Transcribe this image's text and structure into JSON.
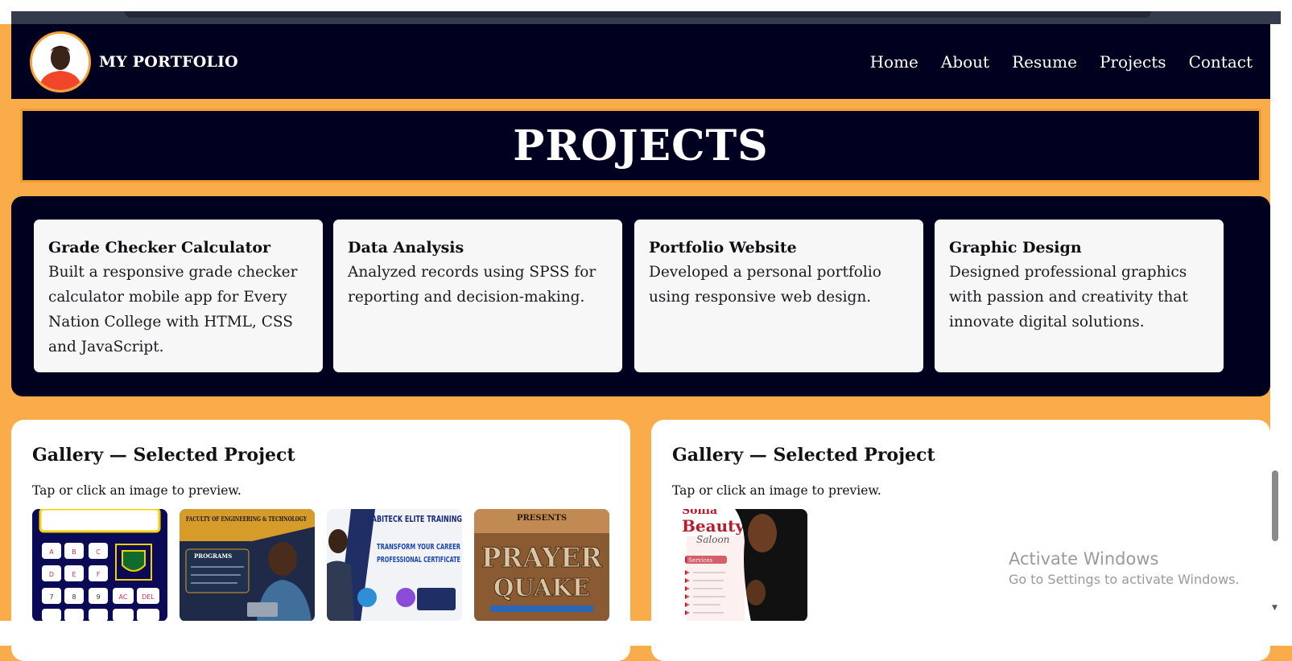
{
  "header": {
    "brand": "MY PORTFOLIO",
    "nav": [
      "Home",
      "About",
      "Resume",
      "Projects",
      "Contact"
    ]
  },
  "projects_banner": {
    "title": "PROJECTS"
  },
  "projects": [
    {
      "title": "Grade Checker Calculator",
      "description": "Built a responsive grade checker calculator mobile app for Every Nation College with HTML, CSS and JavaScript."
    },
    {
      "title": "Data Analysis",
      "description": "Analyzed records using SPSS for reporting and decision-making."
    },
    {
      "title": "Portfolio Website",
      "description": "Developed a personal portfolio using responsive web design."
    },
    {
      "title": "Graphic Design",
      "description": "Designed professional graphics with passion and creativity that innovate digital solutions."
    }
  ],
  "galleries": [
    {
      "title": "Gallery — Selected Project",
      "hint": "Tap or click an image to preview.",
      "thumbnail_texts": {
        "calc_keys": [
          "A",
          "B",
          "C",
          "D",
          "E",
          "F",
          "7",
          "8",
          "9",
          "AC",
          "DEL"
        ],
        "faculty_heading": "FACULTY OF ENGINEERING & TECHNOLOGY",
        "faculty_sub": "PROGRAMS",
        "training_heading": "SABITECK ELITE TRAINING",
        "training_line1": "TRANSFORM YOUR CAREER",
        "training_line2": "PROFESSIONAL CERTIFICATE",
        "event_top": "PRESENTS",
        "event_line1": "PRAYER",
        "event_line2": "QUAKE"
      }
    },
    {
      "title": "Gallery — Selected Project",
      "hint": "Tap or click an image to preview.",
      "thumbnail_texts": {
        "salon_top": "Sonia",
        "salon_line1": "Beauty",
        "salon_line2": "Saloon",
        "salon_services": "Services"
      }
    }
  ],
  "watermark": {
    "title": "Activate Windows",
    "subtitle": "Go to Settings to activate Windows."
  },
  "colors": {
    "navy": "#00001f",
    "accent_orange": "#fbac4a",
    "card_bg": "#f7f7f8"
  }
}
